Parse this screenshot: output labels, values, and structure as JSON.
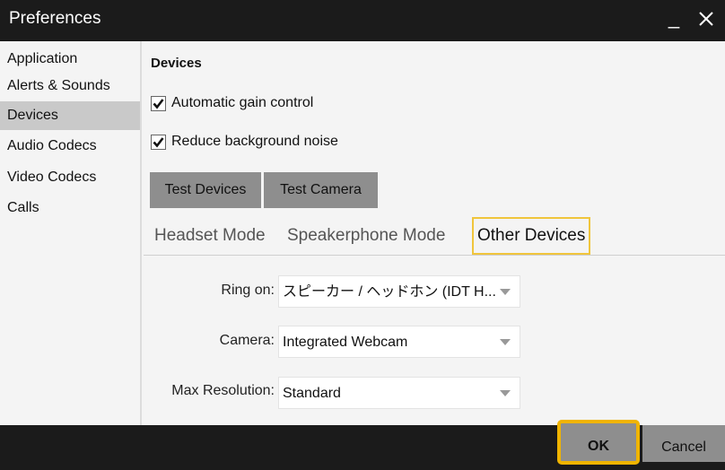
{
  "window": {
    "title": "Preferences",
    "minimize_label": "_"
  },
  "sidebar": {
    "items": [
      {
        "label": "Application"
      },
      {
        "label": "Alerts & Sounds"
      },
      {
        "label": "Devices"
      },
      {
        "label": "Audio Codecs"
      },
      {
        "label": "Video Codecs"
      },
      {
        "label": "Calls"
      }
    ],
    "selected": "Devices"
  },
  "main": {
    "section_title": "Devices",
    "checkboxes": [
      {
        "label": "Automatic gain control",
        "checked": true
      },
      {
        "label": "Reduce background noise",
        "checked": true
      }
    ],
    "buttons": {
      "test_devices": "Test Devices",
      "test_camera": "Test Camera"
    },
    "tabs": [
      {
        "label": "Headset Mode"
      },
      {
        "label": "Speakerphone Mode"
      },
      {
        "label": "Other Devices",
        "active": true
      }
    ],
    "form": {
      "ring_on": {
        "label": "Ring on:",
        "value": "スピーカー / ヘッドホン (IDT H..."
      },
      "camera": {
        "label": "Camera:",
        "value": "Integrated Webcam"
      },
      "max_resolution": {
        "label": "Max Resolution:",
        "value": "Standard"
      }
    }
  },
  "footer": {
    "ok_label": "OK",
    "cancel_label": "Cancel"
  },
  "colors": {
    "highlight": "#f0b400",
    "button_gray": "#8e8e8e",
    "titlebar": "#1b1b1b"
  }
}
